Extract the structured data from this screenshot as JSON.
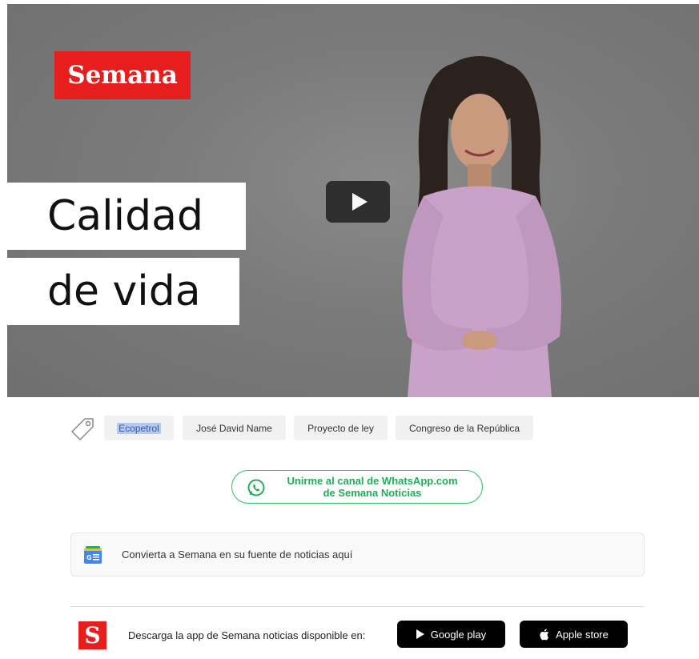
{
  "video": {
    "brand": "Semana",
    "title_line1": "Calidad",
    "title_line2": "de vida"
  },
  "tags": [
    "Ecopetrol",
    "José David Name",
    "Proyecto de ley",
    "Congreso de la República"
  ],
  "whatsapp": {
    "line1": "Unirme al canal de WhatsApp.com",
    "line2": "de Semana Noticias",
    "color": "#26c265"
  },
  "google_news": {
    "text": "Convierta a Semana en su fuente de noticias aquí"
  },
  "app_bar": {
    "logo": "S",
    "text": "Descarga la app de Semana noticias disponible en:",
    "google_play": "Google play",
    "apple_store": "Apple store"
  },
  "colors": {
    "brand_red": "#e61e1e"
  }
}
